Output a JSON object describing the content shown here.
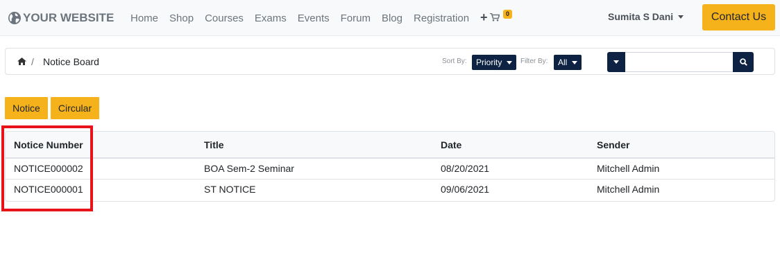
{
  "brand": {
    "name": "YOUR WEBSITE",
    "icon": "globe-icon"
  },
  "nav": {
    "items": [
      {
        "label": "Home"
      },
      {
        "label": "Shop"
      },
      {
        "label": "Courses"
      },
      {
        "label": "Exams"
      },
      {
        "label": "Events"
      },
      {
        "label": "Forum"
      },
      {
        "label": "Blog"
      },
      {
        "label": "Registration"
      }
    ],
    "plus": "+",
    "cart_count": "0",
    "user_name": "Sumita S Dani",
    "contact_label": "Contact Us"
  },
  "breadcrumb": {
    "separator": "/",
    "current": "Notice Board"
  },
  "controls": {
    "sort_label": "Sort By:",
    "sort_value": "Priority",
    "filter_label": "Filter By:",
    "filter_value": "All",
    "search_value": ""
  },
  "tabs": [
    {
      "label": "Notice"
    },
    {
      "label": "Circular"
    }
  ],
  "table": {
    "headers": [
      "Notice Number",
      "Title",
      "Date",
      "Sender"
    ],
    "rows": [
      [
        "NOTICE000002",
        "BOA Sem-2 Seminar",
        "08/20/2021",
        "Mitchell Admin"
      ],
      [
        "NOTICE000001",
        "ST NOTICE",
        "09/06/2021",
        "Mitchell Admin"
      ]
    ]
  },
  "colors": {
    "accent": "#f5b21b",
    "dark_button": "#0e2344",
    "highlight": "#e8131a"
  }
}
